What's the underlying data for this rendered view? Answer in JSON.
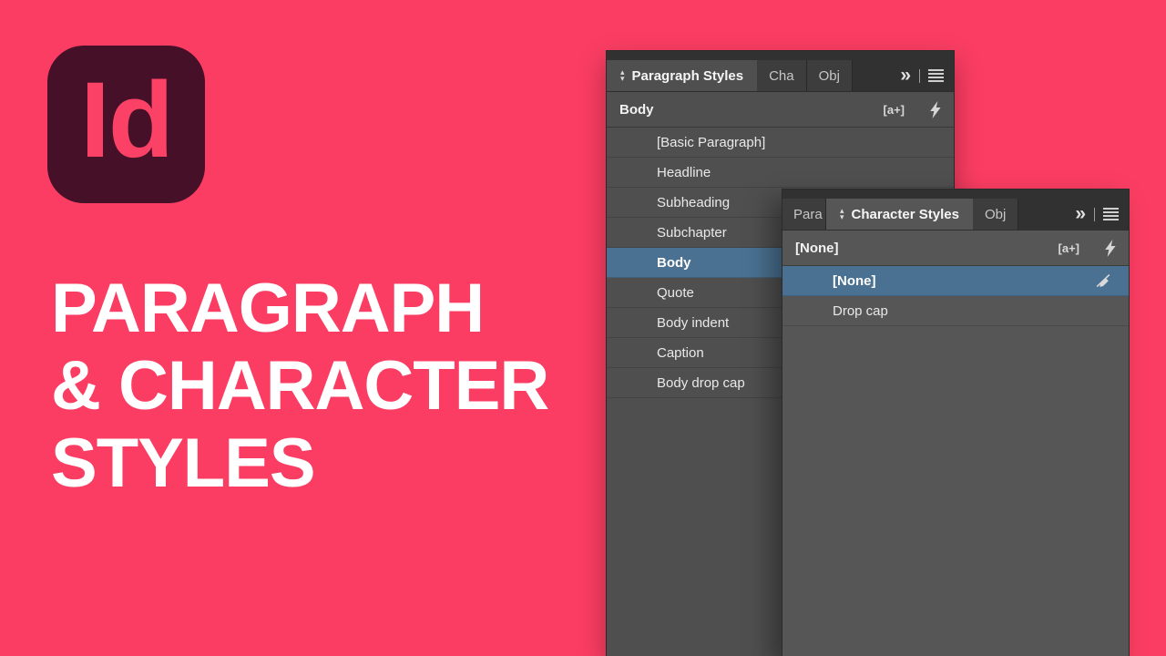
{
  "colors": {
    "background": "#FB3D63",
    "logo_bg": "#451028",
    "panel_bg": "#4F4F4F",
    "panel_bg_character": "#565656",
    "tabstrip_bg": "#313131",
    "selection_blue": "#4A7191",
    "title_text": "#FFFFFF"
  },
  "logo": {
    "text": "Id"
  },
  "title": {
    "lines": [
      "PARAGRAPH",
      "& CHARACTER",
      "STYLES"
    ]
  },
  "icons": {
    "collapse_up": "▴",
    "collapse_down": "▾",
    "expand": "»"
  },
  "paragraph_panel": {
    "active_tab": "Paragraph Styles",
    "tab_truncated_character": "Cha",
    "tab_truncated_object": "Obj",
    "style_field": "Body",
    "override_icon": "[a+]",
    "rows": [
      {
        "label": "[Basic Paragraph]",
        "selected": false
      },
      {
        "label": "Headline",
        "selected": false
      },
      {
        "label": "Subheading",
        "selected": false
      },
      {
        "label": "Subchapter",
        "selected": false
      },
      {
        "label": "Body",
        "selected": true
      },
      {
        "label": "Quote",
        "selected": false
      },
      {
        "label": "Body indent",
        "selected": false
      },
      {
        "label": "Caption",
        "selected": false
      },
      {
        "label": "Body drop cap",
        "selected": false
      }
    ]
  },
  "character_panel": {
    "active_tab": "Character Styles",
    "tab_truncated_paragraph": "Para",
    "tab_truncated_object": "Obj",
    "style_field": "[None]",
    "override_icon": "[a+]",
    "rows": [
      {
        "label": "[None]",
        "selected": true
      },
      {
        "label": "Drop cap",
        "selected": false
      }
    ]
  }
}
